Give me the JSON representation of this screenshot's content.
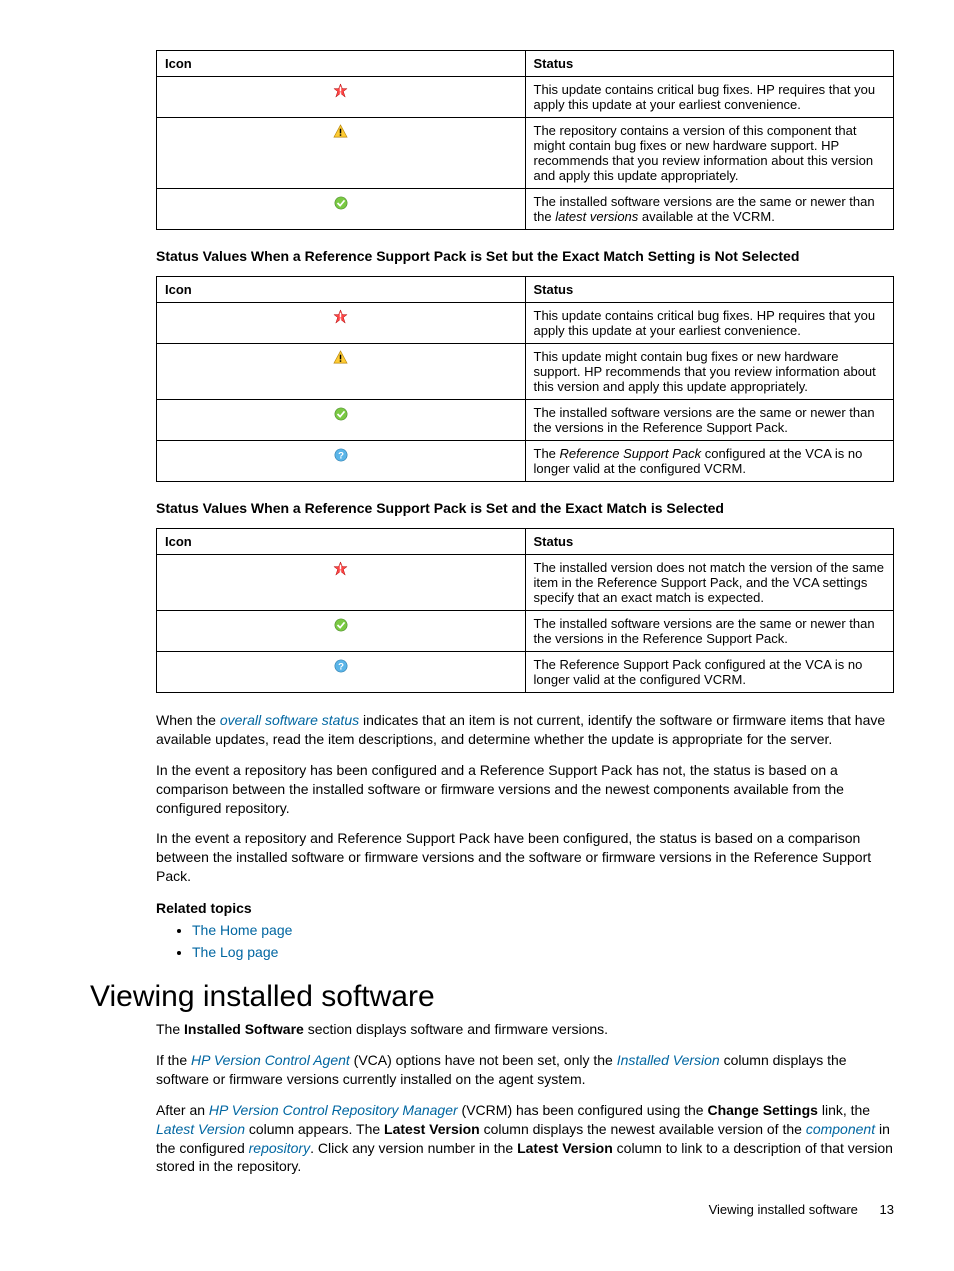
{
  "table1": {
    "header": {
      "icon": "Icon",
      "status": "Status"
    },
    "rows": [
      {
        "icon": "critical",
        "status": "This update contains critical bug fixes. HP requires that you apply this update at your earliest convenience."
      },
      {
        "icon": "warning",
        "status": "The repository contains a version of this component that might contain bug fixes or new hardware support. HP recommends that you review information about this version and apply this update appropriately."
      },
      {
        "icon": "ok",
        "status_pre": "The installed software versions are the same or newer than the ",
        "status_italic": "latest versions",
        "status_post": " available at the VCRM."
      }
    ]
  },
  "caption2": "Status Values When a Reference Support Pack is Set but the Exact Match Setting is Not Selected",
  "table2": {
    "header": {
      "icon": "Icon",
      "status": "Status"
    },
    "rows": [
      {
        "icon": "critical",
        "status": "This update contains critical bug fixes. HP requires that you apply this update at your earliest convenience."
      },
      {
        "icon": "warning",
        "status": "This update might contain bug fixes or new hardware support. HP recommends that you review information about this version and apply this update appropriately."
      },
      {
        "icon": "ok",
        "status": "The installed software versions are the same or newer than the versions in the Reference Support Pack."
      },
      {
        "icon": "info",
        "status_pre": "The ",
        "status_italic": "Reference Support Pack",
        "status_post": " configured at the VCA is no longer valid at the configured VCRM."
      }
    ]
  },
  "caption3": "Status Values When a Reference Support Pack is Set and the Exact Match is Selected",
  "table3": {
    "header": {
      "icon": "Icon",
      "status": "Status"
    },
    "rows": [
      {
        "icon": "critical",
        "status": "The installed version does not match the version of the same item in the Reference Support Pack, and the VCA settings specify that an exact match is expected."
      },
      {
        "icon": "ok",
        "status": "The installed software versions are the same or newer than the versions in the Reference Support Pack."
      },
      {
        "icon": "info",
        "status": "The Reference Support Pack configured at the VCA is no longer valid at the configured VCRM."
      }
    ]
  },
  "para1_pre": "When the ",
  "para1_italic": "overall software status",
  "para1_post": " indicates that an item is not current, identify the software or firmware items that have available updates, read the item descriptions, and determine whether the update is appropriate for the server.",
  "para2": "In the event a repository has been configured and a Reference Support Pack has not, the status is based on a comparison between the installed software or firmware versions and the newest components available from the configured repository.",
  "para3": "In the event a repository and Reference Support Pack have been configured, the status is based on a comparison between the installed software or firmware versions and the software or firmware versions in the Reference Support Pack.",
  "related_title": "Related topics",
  "related_links": [
    "The Home page",
    "The Log page"
  ],
  "heading": "Viewing installed software",
  "p4_pre": "The ",
  "p4_bold": "Installed Software",
  "p4_post": " section displays software and firmware versions.",
  "p5_a": "If the ",
  "p5_b": "HP Version Control Agent",
  "p5_c": " (VCA) options have not been set, only the ",
  "p5_d": "Installed Version",
  "p5_e": " column displays the software or firmware versions currently installed on the agent system.",
  "p6_a": "After an ",
  "p6_b": "HP Version Control Repository Manager",
  "p6_c": " (VCRM) has been configured using the ",
  "p6_d": "Change Settings",
  "p6_e": " link, the ",
  "p6_f": "Latest Version",
  "p6_g": " column appears. The ",
  "p6_h": "Latest Version",
  "p6_i": " column displays the newest available version of the ",
  "p6_j": "component",
  "p6_k": " in the configured ",
  "p6_l": "repository",
  "p6_m": ". Click any version number in the ",
  "p6_n": "Latest Version",
  "p6_o": " column to link to a description of that version stored in the repository.",
  "footer_text": "Viewing installed software",
  "footer_page": "13"
}
